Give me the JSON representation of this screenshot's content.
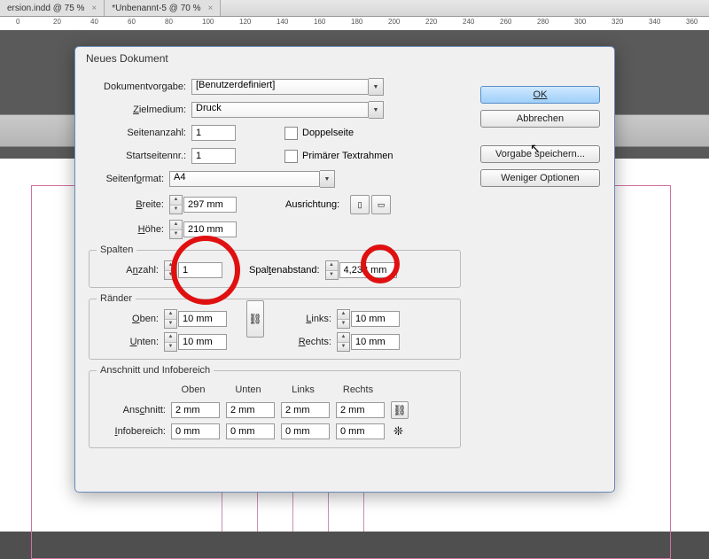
{
  "tabs": [
    {
      "label": "ersion.indd @ 75 %"
    },
    {
      "label": "*Unbenannt-5 @ 70 %"
    }
  ],
  "ruler_marks": [
    "0",
    "20",
    "40",
    "60",
    "80",
    "100",
    "120",
    "140",
    "160",
    "180",
    "200",
    "220",
    "240",
    "260",
    "280",
    "300",
    "320",
    "340",
    "360"
  ],
  "dialog": {
    "title": "Neues Dokument",
    "labels": {
      "preset": "Dokumentvorgabe:",
      "intent": "Zielmedium:",
      "pages": "Seitenanzahl:",
      "start": "Startseitennr.:",
      "facing": "Doppelseite",
      "primary": "Primärer Textrahmen",
      "size": "Seitenformat:",
      "width": "Breite:",
      "height": "Höhe:",
      "orient": "Ausrichtung:",
      "columns_legend": "Spalten",
      "col_count": "Anzahl:",
      "gutter": "Spaltenabstand:",
      "margins_legend": "Ränder",
      "top": "Oben:",
      "bottom": "Unten:",
      "left": "Links:",
      "right": "Rechts:",
      "bleed_legend": "Anschnitt und Infobereich",
      "col_top": "Oben",
      "col_bottom": "Unten",
      "col_left": "Links",
      "col_right": "Rechts",
      "bleed": "Anschnitt:",
      "slug": "Infobereich:"
    },
    "values": {
      "preset": "[Benutzerdefiniert]",
      "intent": "Druck",
      "pages": "1",
      "start": "1",
      "size": "A4",
      "width": "297 mm",
      "height": "210 mm",
      "col_count": "1",
      "gutter": "4,233 mm",
      "m_top": "10 mm",
      "m_bottom": "10 mm",
      "m_left": "10 mm",
      "m_right": "10 mm",
      "b_top": "2 mm",
      "b_bottom": "2 mm",
      "b_left": "2 mm",
      "b_right": "2 mm",
      "s_top": "0 mm",
      "s_bottom": "0 mm",
      "s_left": "0 mm",
      "s_right": "0 mm"
    },
    "buttons": {
      "ok": "OK",
      "cancel": "Abbrechen",
      "save": "Vorgabe speichern...",
      "less": "Weniger Optionen"
    }
  }
}
